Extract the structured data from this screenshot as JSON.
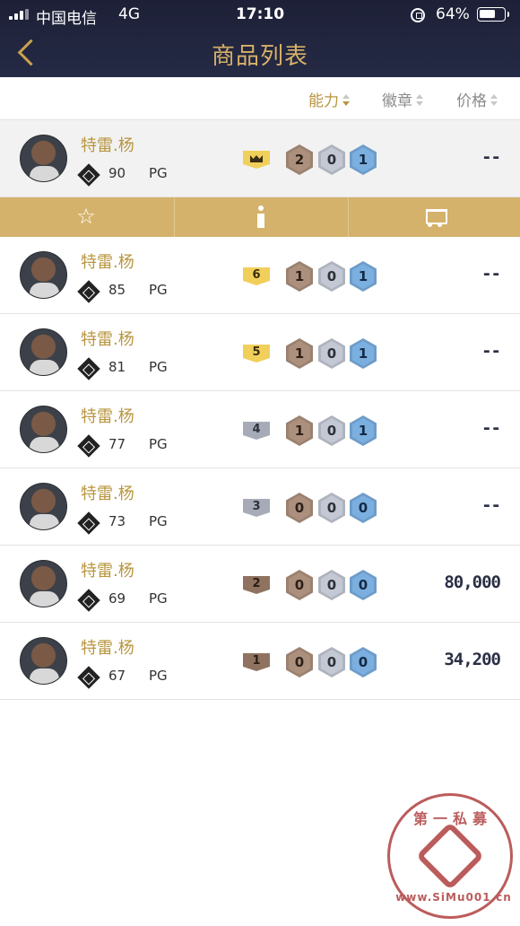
{
  "status_bar": {
    "carrier": "中国电信",
    "network": "4G",
    "time": "17:10",
    "battery": "64%",
    "battery_level": 0.64
  },
  "nav": {
    "back_icon": "chevron-left-icon",
    "title": "商品列表"
  },
  "sort": {
    "ability": "能力",
    "badge": "徽章",
    "price": "价格",
    "active": "ability"
  },
  "actions": {
    "favorite_icon": "star-icon",
    "info_icon": "info-icon",
    "cart_icon": "cart-icon"
  },
  "rows": [
    {
      "name": "特雷.杨",
      "ovr": "90",
      "pos": "PG",
      "tier": "crown",
      "tier_color": "gold",
      "b1": "2",
      "b2": "0",
      "b3": "1",
      "price": "--"
    },
    {
      "name": "特雷.杨",
      "ovr": "85",
      "pos": "PG",
      "tier": "6",
      "tier_color": "gold",
      "b1": "1",
      "b2": "0",
      "b3": "1",
      "price": "--"
    },
    {
      "name": "特雷.杨",
      "ovr": "81",
      "pos": "PG",
      "tier": "5",
      "tier_color": "gold",
      "b1": "1",
      "b2": "0",
      "b3": "1",
      "price": "--"
    },
    {
      "name": "特雷.杨",
      "ovr": "77",
      "pos": "PG",
      "tier": "4",
      "tier_color": "silver",
      "b1": "1",
      "b2": "0",
      "b3": "1",
      "price": "--"
    },
    {
      "name": "特雷.杨",
      "ovr": "73",
      "pos": "PG",
      "tier": "3",
      "tier_color": "silver",
      "b1": "0",
      "b2": "0",
      "b3": "0",
      "price": "--"
    },
    {
      "name": "特雷.杨",
      "ovr": "69",
      "pos": "PG",
      "tier": "2",
      "tier_color": "bronze",
      "b1": "0",
      "b2": "0",
      "b3": "0",
      "price": "80,000"
    },
    {
      "name": "特雷.杨",
      "ovr": "67",
      "pos": "PG",
      "tier": "1",
      "tier_color": "bronze",
      "b1": "0",
      "b2": "0",
      "b3": "0",
      "price": "34,200"
    }
  ],
  "colors": {
    "nav_bg": "#1d2036",
    "accent_gold": "#b8963f",
    "action_bar": "#d4b26b"
  },
  "watermark": {
    "top": "第一私募",
    "bottom": "www.SiMu001.cn"
  }
}
